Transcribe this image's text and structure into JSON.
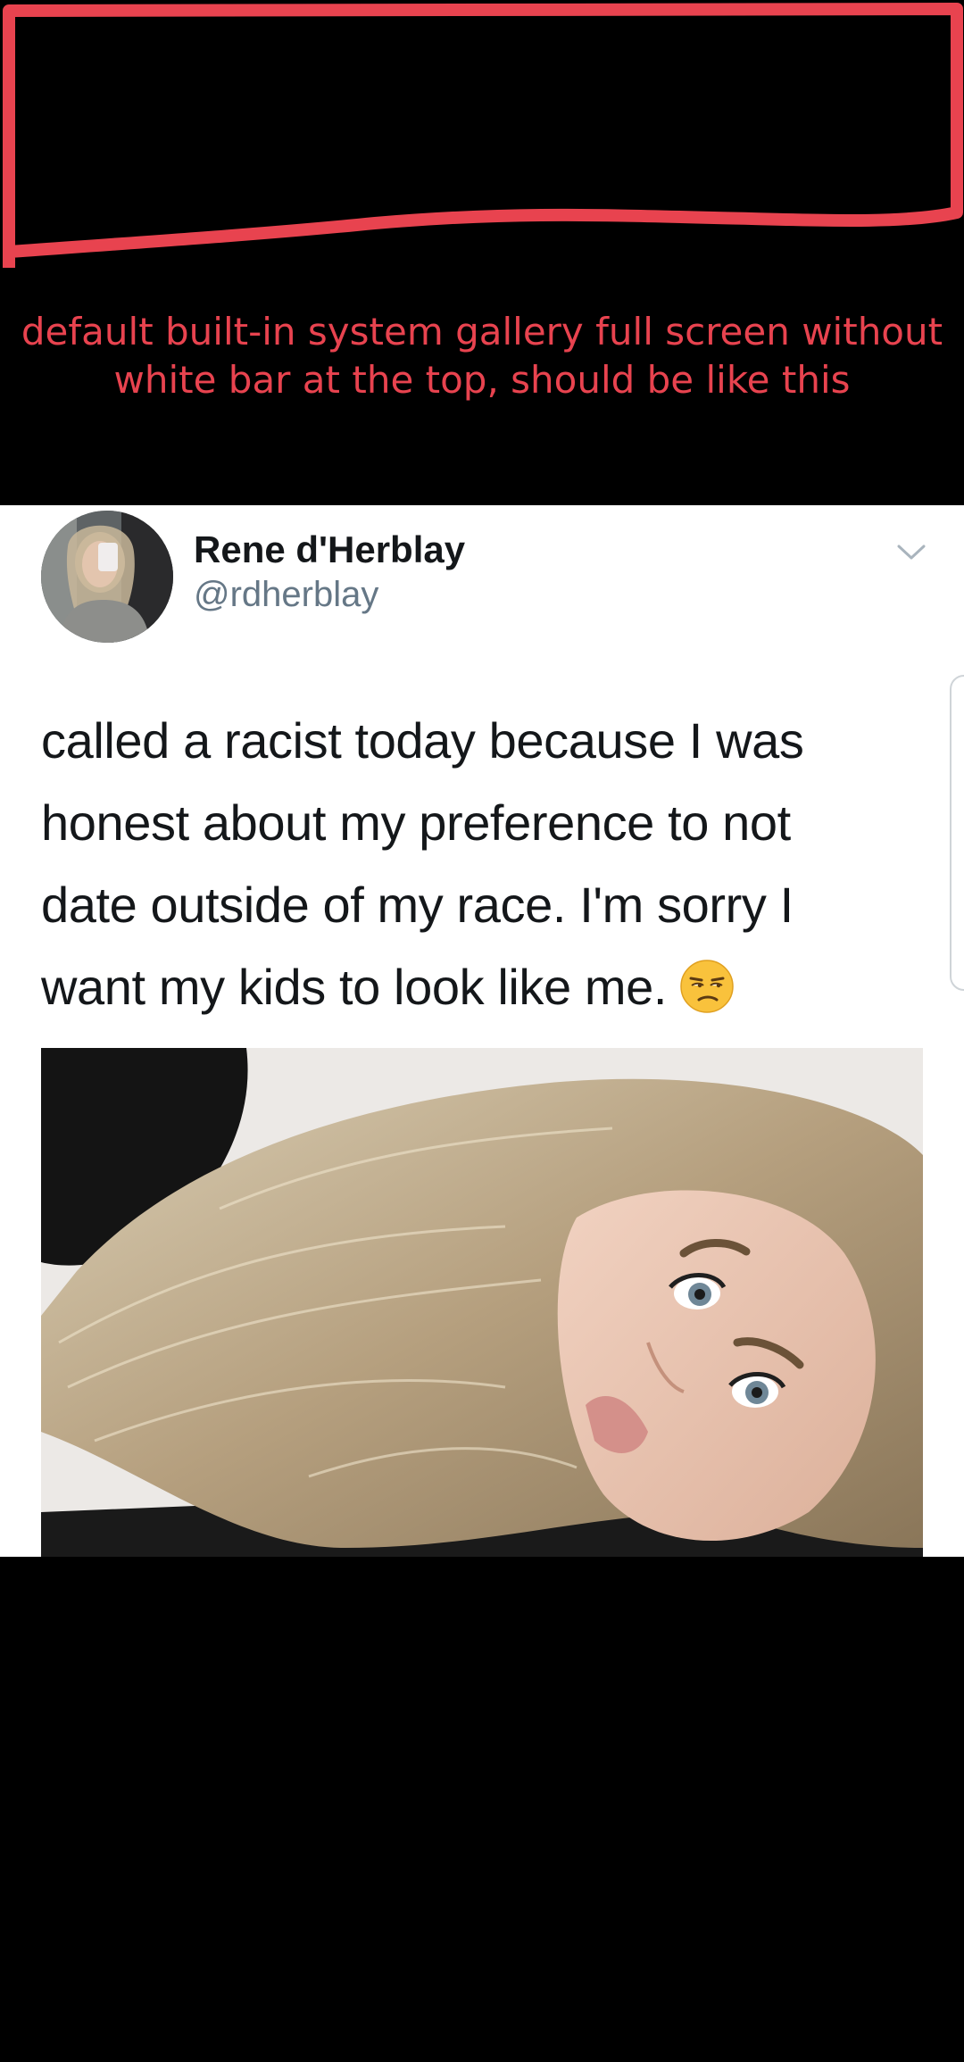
{
  "annotation": {
    "text": "default built-in system gallery full screen without\nwhite bar at the top, should be like this",
    "color": "#e8434f"
  },
  "tweet": {
    "display_name": "Rene d'Herblay",
    "handle": "@rdherblay",
    "text_lines": [
      "called a racist today because I was",
      "honest about my preference to not",
      "date outside of my race. I'm sorry I",
      "want my kids to look like me."
    ],
    "emoji": "unamused-face-icon",
    "menu_icon": "chevron-down-icon"
  },
  "colors": {
    "background": "#000000",
    "card": "#ffffff",
    "name": "#14171a",
    "handle": "#657786"
  }
}
